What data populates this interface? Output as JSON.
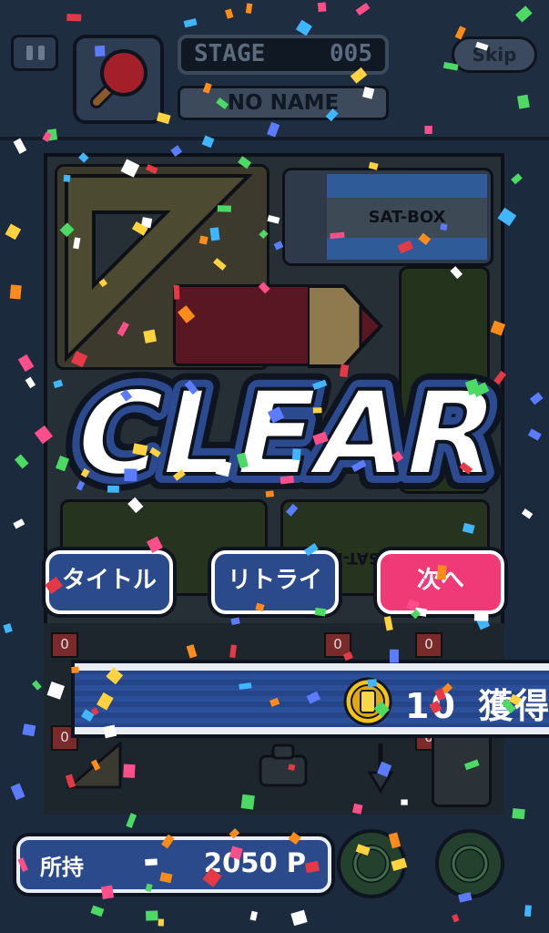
{
  "header": {
    "stage_label": "STAGE",
    "stage_number": "005",
    "player_name": "NO NAME",
    "skip_label": "Skip",
    "item_icon": "ping-pong-paddle-icon"
  },
  "board": {
    "box_label": "SAT-BOX",
    "box_label_flipped": "SAT-BOX",
    "counters": [
      "0",
      "0",
      "0",
      "0",
      "0"
    ]
  },
  "result": {
    "title": "CLEAR"
  },
  "buttons": {
    "title_label": "タイトル",
    "retry_label": "リトライ",
    "next_label": "次へ"
  },
  "reward": {
    "amount": "10",
    "suffix": "獲得",
    "icon": "coin-icon"
  },
  "balance": {
    "label": "所持",
    "value": "2050 P"
  },
  "colors": {
    "accent_pink": "#f03a78",
    "button_blue": "#2a4a8c",
    "coin_gold": "#f3c316",
    "background": "#1c2a3e"
  }
}
